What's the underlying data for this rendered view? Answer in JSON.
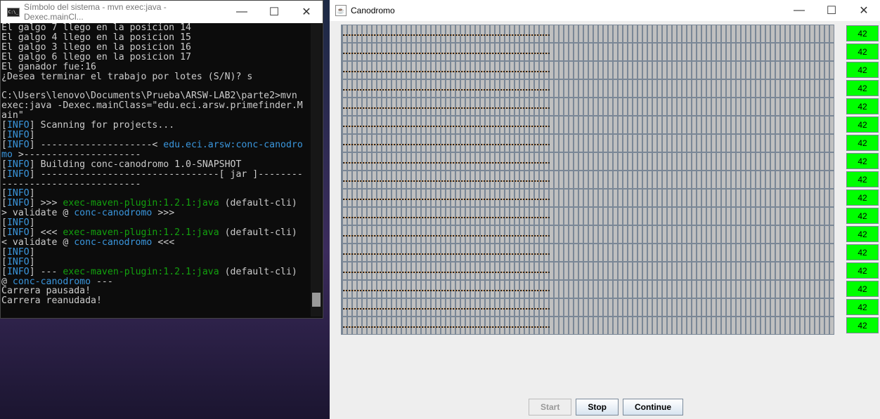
{
  "terminal": {
    "title": "Símbolo del sistema - mvn  exec:java -Dexec.mainCl...",
    "icon_label": "C:\\_",
    "lines": [
      [
        {
          "t": "El galgo 7 llego en la posicion 14"
        }
      ],
      [
        {
          "t": "El galgo 4 llego en la posicion 15"
        }
      ],
      [
        {
          "t": "El galgo 3 llego en la posicion 16"
        }
      ],
      [
        {
          "t": "El galgo 6 llego en la posicion 17"
        }
      ],
      [
        {
          "t": "El ganador fue:16"
        }
      ],
      [
        {
          "t": "¿Desea terminar el trabajo por lotes (S/N)? s"
        }
      ],
      [
        {
          "t": ""
        }
      ],
      [
        {
          "t": "C:\\Users\\lenovo\\Documents\\Prueba\\ARSW-LAB2\\parte2>mvn"
        }
      ],
      [
        {
          "t": "exec:java -Dexec.mainClass=\"edu.eci.arsw.primefinder.M"
        }
      ],
      [
        {
          "t": "ain\""
        }
      ],
      [
        {
          "t": "[",
          "c": ""
        },
        {
          "t": "INFO",
          "c": "b"
        },
        {
          "t": "] Scanning for projects..."
        }
      ],
      [
        {
          "t": "["
        },
        {
          "t": "INFO",
          "c": "b"
        },
        {
          "t": "]"
        }
      ],
      [
        {
          "t": "["
        },
        {
          "t": "INFO",
          "c": "b"
        },
        {
          "t": "] --------------------< "
        },
        {
          "t": "edu.eci.arsw:conc-canodro",
          "c": "b"
        }
      ],
      [
        {
          "t": "mo",
          "c": "b"
        },
        {
          "t": " >---------------------"
        }
      ],
      [
        {
          "t": "["
        },
        {
          "t": "INFO",
          "c": "b"
        },
        {
          "t": "] Building conc-canodromo 1.0-SNAPSHOT"
        }
      ],
      [
        {
          "t": "["
        },
        {
          "t": "INFO",
          "c": "b"
        },
        {
          "t": "] --------------------------------[ jar ]--------"
        }
      ],
      [
        {
          "t": "-------------------------"
        }
      ],
      [
        {
          "t": "["
        },
        {
          "t": "INFO",
          "c": "b"
        },
        {
          "t": "]"
        }
      ],
      [
        {
          "t": "["
        },
        {
          "t": "INFO",
          "c": "b"
        },
        {
          "t": "] >>> "
        },
        {
          "t": "exec-maven-plugin:1.2.1:java",
          "c": "g"
        },
        {
          "t": " (default-cli)"
        }
      ],
      [
        {
          "t": "> validate @ "
        },
        {
          "t": "conc-canodromo",
          "c": "b"
        },
        {
          "t": " >>>"
        }
      ],
      [
        {
          "t": "["
        },
        {
          "t": "INFO",
          "c": "b"
        },
        {
          "t": "]"
        }
      ],
      [
        {
          "t": "["
        },
        {
          "t": "INFO",
          "c": "b"
        },
        {
          "t": "] <<< "
        },
        {
          "t": "exec-maven-plugin:1.2.1:java",
          "c": "g"
        },
        {
          "t": " (default-cli)"
        }
      ],
      [
        {
          "t": "< validate @ "
        },
        {
          "t": "conc-canodromo",
          "c": "b"
        },
        {
          "t": " <<<"
        }
      ],
      [
        {
          "t": "["
        },
        {
          "t": "INFO",
          "c": "b"
        },
        {
          "t": "]"
        }
      ],
      [
        {
          "t": "["
        },
        {
          "t": "INFO",
          "c": "b"
        },
        {
          "t": "]"
        }
      ],
      [
        {
          "t": "["
        },
        {
          "t": "INFO",
          "c": "b"
        },
        {
          "t": "] --- "
        },
        {
          "t": "exec-maven-plugin:1.2.1:java",
          "c": "g"
        },
        {
          "t": " (default-cli)"
        }
      ],
      [
        {
          "t": "@ "
        },
        {
          "t": "conc-canodromo",
          "c": "b"
        },
        {
          "t": " ---"
        }
      ],
      [
        {
          "t": "Carrera pausada!"
        }
      ],
      [
        {
          "t": "Carrera reanudada!"
        }
      ]
    ]
  },
  "app": {
    "title": "Canodromo",
    "lane_count": 17,
    "track_cells": 100,
    "progress_cells": 42,
    "positions": [
      "42",
      "42",
      "42",
      "42",
      "42",
      "42",
      "42",
      "42",
      "42",
      "42",
      "42",
      "42",
      "42",
      "42",
      "42",
      "42",
      "42"
    ],
    "buttons": {
      "start": "Start",
      "stop": "Stop",
      "continue": "Continue"
    },
    "start_enabled": false,
    "label_color": "#00ff00"
  }
}
